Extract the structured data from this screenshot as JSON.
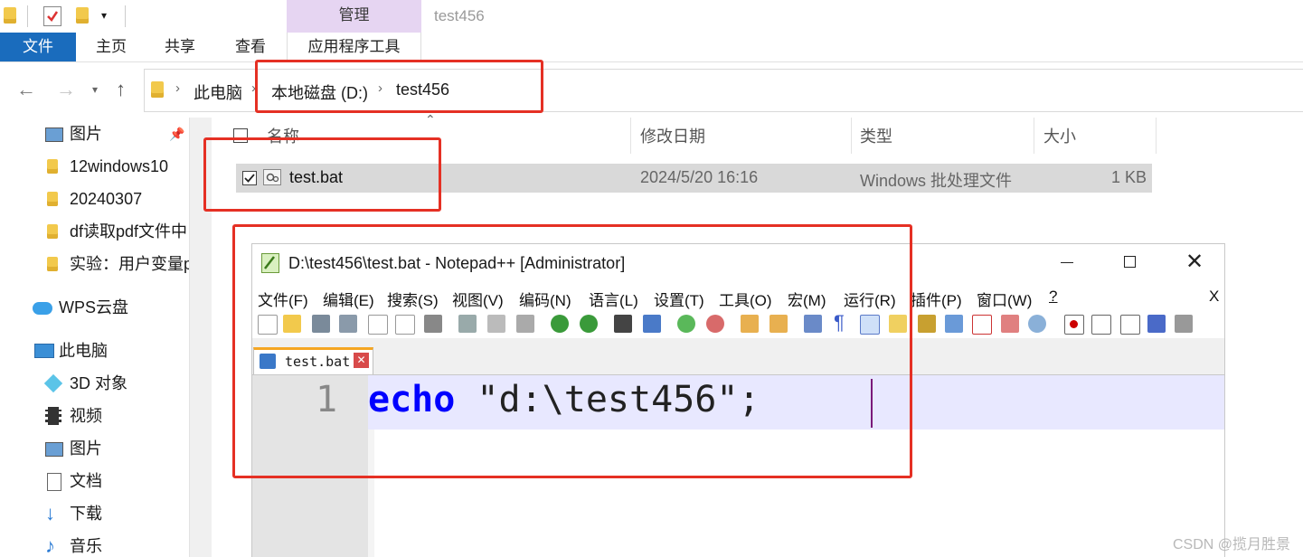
{
  "explorer": {
    "title": "test456",
    "manage_tab": "管理",
    "ribbon_tabs": [
      "文件",
      "主页",
      "共享",
      "查看",
      "应用程序工具"
    ],
    "breadcrumb": [
      "此电脑",
      "本地磁盘 (D:)",
      "test456"
    ],
    "sidebar": [
      {
        "label": "图片",
        "icon": "pictures-icon"
      },
      {
        "label": "12windows10",
        "icon": "folder-icon"
      },
      {
        "label": "20240307",
        "icon": "folder-icon"
      },
      {
        "label": "df读取pdf文件中",
        "icon": "folder-icon"
      },
      {
        "label": "实验：用户变量p",
        "icon": "folder-icon"
      },
      {
        "label": "WPS云盘",
        "icon": "cloud-icon"
      },
      {
        "label": "此电脑",
        "icon": "computer-icon"
      },
      {
        "label": "3D 对象",
        "icon": "cube-icon"
      },
      {
        "label": "视频",
        "icon": "video-icon"
      },
      {
        "label": "图片",
        "icon": "pictures-icon"
      },
      {
        "label": "文档",
        "icon": "document-icon"
      },
      {
        "label": "下载",
        "icon": "download-icon"
      },
      {
        "label": "音乐",
        "icon": "music-icon"
      }
    ],
    "columns": {
      "name": "名称",
      "modified": "修改日期",
      "type": "类型",
      "size": "大小"
    },
    "files": [
      {
        "name": "test.bat",
        "modified": "2024/5/20 16:16",
        "type": "Windows 批处理文件",
        "size": "1 KB"
      }
    ]
  },
  "notepad": {
    "title": "D:\\test456\\test.bat - Notepad++ [Administrator]",
    "menu": [
      "文件(F)",
      "编辑(E)",
      "搜索(S)",
      "视图(V)",
      "编码(N)",
      "语言(L)",
      "设置(T)",
      "工具(O)",
      "宏(M)",
      "运行(R)",
      "插件(P)",
      "窗口(W)",
      "?"
    ],
    "close_doc": "X",
    "tab_label": "test.bat",
    "line_number": "1",
    "code_keyword": "echo",
    "code_rest": " \"d:\\test456\";"
  },
  "watermark": "CSDN @揽月胜景",
  "colors": {
    "accent": "#1a6cbd",
    "annotation_red": "#e53024",
    "keyword_blue": "#0000ff",
    "manage_tab_bg": "#e6d5f2"
  }
}
